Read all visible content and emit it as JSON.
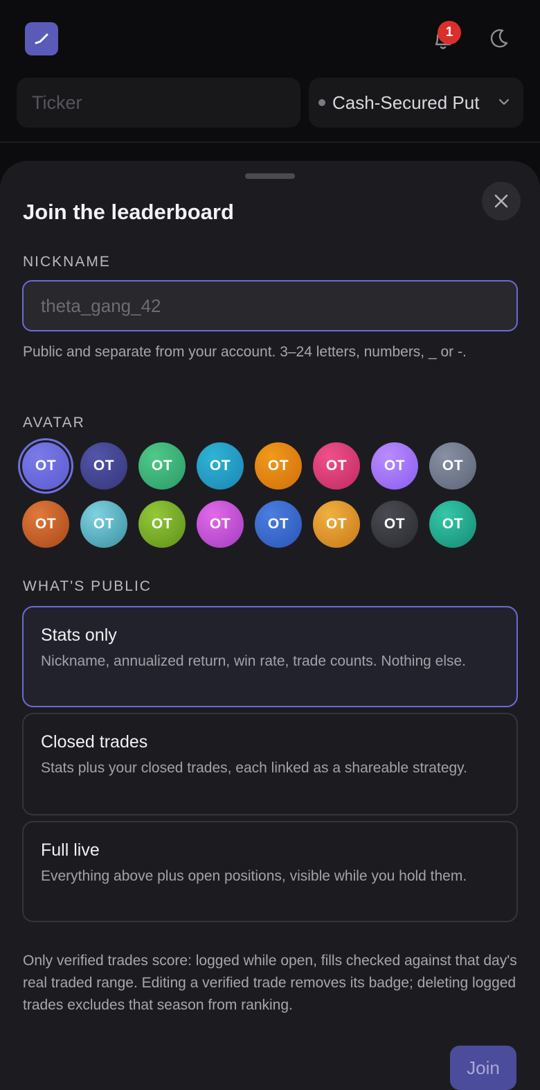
{
  "header": {
    "ticker_placeholder": "Ticker",
    "strategy_selected": "Cash-Secured Put",
    "notification_count": "1"
  },
  "sheet": {
    "title": "Join the leaderboard",
    "nickname": {
      "label": "NICKNAME",
      "placeholder": "theta_gang_42",
      "value": "",
      "hint": "Public and separate from your account. 3–24 letters, numbers, _ or -."
    },
    "avatar": {
      "label": "AVATAR",
      "initials": "OT",
      "colors": [
        [
          "#7b7ae8",
          "#5c5bd0"
        ],
        [
          "#5355a8",
          "#34367a"
        ],
        [
          "#4fc98a",
          "#2b9a66"
        ],
        [
          "#2fb3d8",
          "#1b86b0"
        ],
        [
          "#f09a1a",
          "#d06e0a"
        ],
        [
          "#f0508a",
          "#c02a60"
        ],
        [
          "#b88cff",
          "#8a5cf0"
        ],
        [
          "#8890a4",
          "#5d6478"
        ],
        [
          "#e0793a",
          "#a8481a"
        ],
        [
          "#7fd2e0",
          "#3c8fa0"
        ],
        [
          "#92c83a",
          "#5e9018"
        ],
        [
          "#e06ae8",
          "#a43cc0"
        ],
        [
          "#4a7ee0",
          "#2a56b8"
        ],
        [
          "#f0b040",
          "#c87818"
        ],
        [
          "#4a4a52",
          "#2a2a30"
        ],
        [
          "#34c8a8",
          "#168a74"
        ]
      ],
      "selected_index": 0
    },
    "visibility": {
      "label": "WHAT'S PUBLIC",
      "options": [
        {
          "title": "Stats only",
          "desc": "Nickname, annualized return, win rate, trade counts. Nothing else.",
          "selected": true
        },
        {
          "title": "Closed trades",
          "desc": "Stats plus your closed trades, each linked as a shareable strategy.",
          "selected": false
        },
        {
          "title": "Full live",
          "desc": "Everything above plus open positions, visible while you hold them.",
          "selected": false
        }
      ]
    },
    "footer_note": "Only verified trades score: logged while open, fills checked against that day's real traded range. Editing a verified trade removes its badge; deleting logged trades excludes that season from ranking.",
    "join_label": "Join"
  }
}
